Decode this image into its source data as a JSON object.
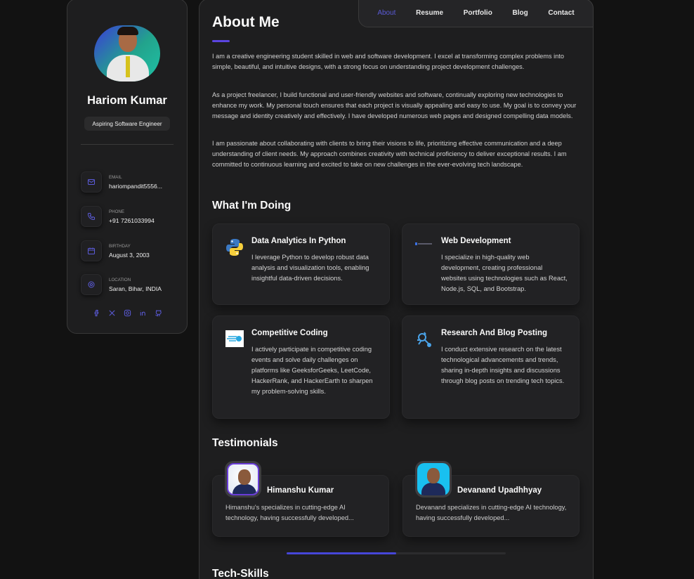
{
  "profile": {
    "name": "Hariom Kumar",
    "title": "Aspiring Software Engineer",
    "contacts": [
      {
        "label": "EMAIL",
        "value": "hariompandit5556...",
        "icon": "mail-icon"
      },
      {
        "label": "PHONE",
        "value": "+91 7261033994",
        "icon": "phone-icon"
      },
      {
        "label": "BIRTHDAY",
        "value": "August 3, 2003",
        "icon": "calendar-icon"
      },
      {
        "label": "LOCATION",
        "value": "Saran, Bihar, INDIA",
        "icon": "location-icon"
      }
    ],
    "socials": [
      "facebook-icon",
      "x-icon",
      "instagram-icon",
      "linkedin-icon",
      "github-icon"
    ]
  },
  "nav": {
    "items": [
      "About",
      "Resume",
      "Portfolio",
      "Blog",
      "Contact"
    ],
    "active": "About"
  },
  "about": {
    "heading": "About Me",
    "paragraphs": [
      "I am a creative engineering student skilled in web and software development. I excel at transforming complex problems into simple, beautiful, and intuitive designs, with a strong focus on understanding project development challenges.",
      "As a project freelancer, I build functional and user-friendly websites and software, continually exploring new technologies to enhance my work. My personal touch ensures that each project is visually appealing and easy to use. My goal is to convey your message and identity creatively and effectively. I have developed numerous web pages and designed compelling data models.",
      "I am passionate about collaborating with clients to bring their visions to life, prioritizing effective communication and a deep understanding of client needs. My approach combines creativity with technical proficiency to deliver exceptional results. I am committed to continuous learning and excited to take on new challenges in the ever-evolving tech landscape."
    ]
  },
  "doing": {
    "heading": "What I'm Doing",
    "services": [
      {
        "title": "Data Analytics In Python",
        "desc": "I leverage Python to develop robust data analysis and visualization tools, enabling insightful data-driven decisions.",
        "icon": "python-icon"
      },
      {
        "title": "Web Development",
        "desc": "I specialize in high-quality web development, creating professional websites using technologies such as React, Node.js, SQL, and Bootstrap.",
        "icon": "web-dev-icon"
      },
      {
        "title": "Competitive Coding",
        "desc": "I actively participate in competitive coding events and solve daily challenges on platforms like GeeksforGeeks, LeetCode, HackerRank, and HackerEarth to sharpen my problem-solving skills.",
        "icon": "coding-icon"
      },
      {
        "title": "Research And Blog Posting",
        "desc": "I conduct extensive research on the latest technological advancements and trends, sharing in-depth insights and discussions through blog posts on trending tech topics.",
        "icon": "research-icon"
      }
    ]
  },
  "testimonials": {
    "heading": "Testimonials",
    "items": [
      {
        "name": "Himanshu Kumar",
        "text": "Himanshu's specializes in cutting-edge AI technology, having successfully developed..."
      },
      {
        "name": "Devanand Upadhhyay",
        "text": "Devanand specializes in cutting-edge AI technology, having successfully developed..."
      }
    ],
    "scroll_progress": 0.5
  },
  "skills": {
    "heading": "Tech-Skills"
  },
  "colors": {
    "accent": "#5b45e0",
    "background": "#121212",
    "card": "#1e1e1f"
  }
}
